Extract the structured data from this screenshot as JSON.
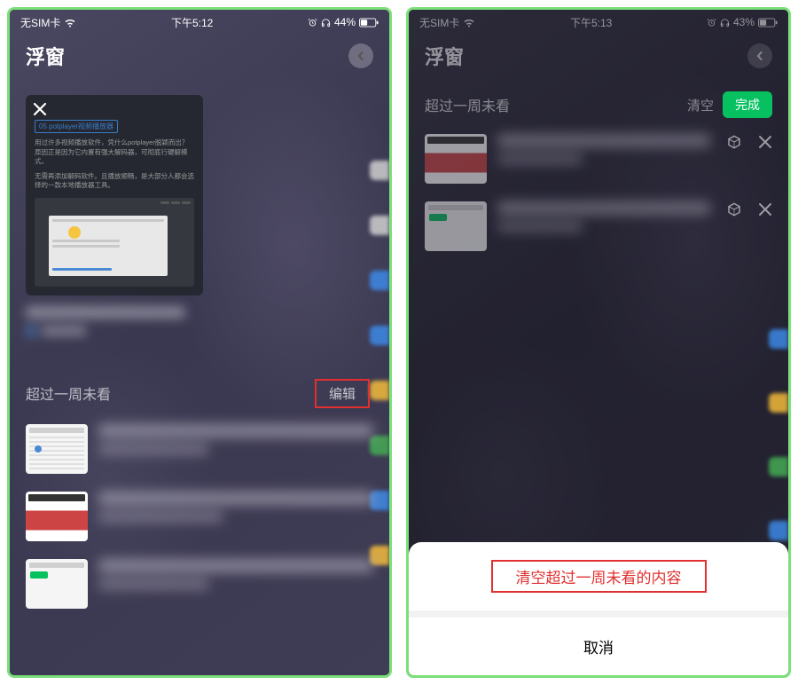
{
  "left": {
    "statusbar": {
      "carrier": "无SIM卡",
      "time": "下午5:12",
      "battery_pct": "44%"
    },
    "header": {
      "title": "浮窗"
    },
    "card": {
      "tag_prefix": "05",
      "tag_text": "potplayer视频播放器",
      "para1": "用过许多视频播放软件，凭什么potplayer脱颖而出？原因正是因为它内置有强大解码器，可彻底行硬解模式。",
      "para2": "无需再添加解码软件。且播放顺畅，是大部分人都会选择的一款本地播放器工具。"
    },
    "section": {
      "title": "超过一周未看",
      "edit": "编辑"
    }
  },
  "right": {
    "statusbar": {
      "carrier": "无SIM卡",
      "time": "下午5:13",
      "battery_pct": "43%"
    },
    "header": {
      "title": "浮窗"
    },
    "section": {
      "title": "超过一周未看",
      "clear": "清空",
      "done": "完成"
    },
    "sheet": {
      "clear_all": "清空超过一周未看的内容",
      "cancel": "取消"
    }
  }
}
